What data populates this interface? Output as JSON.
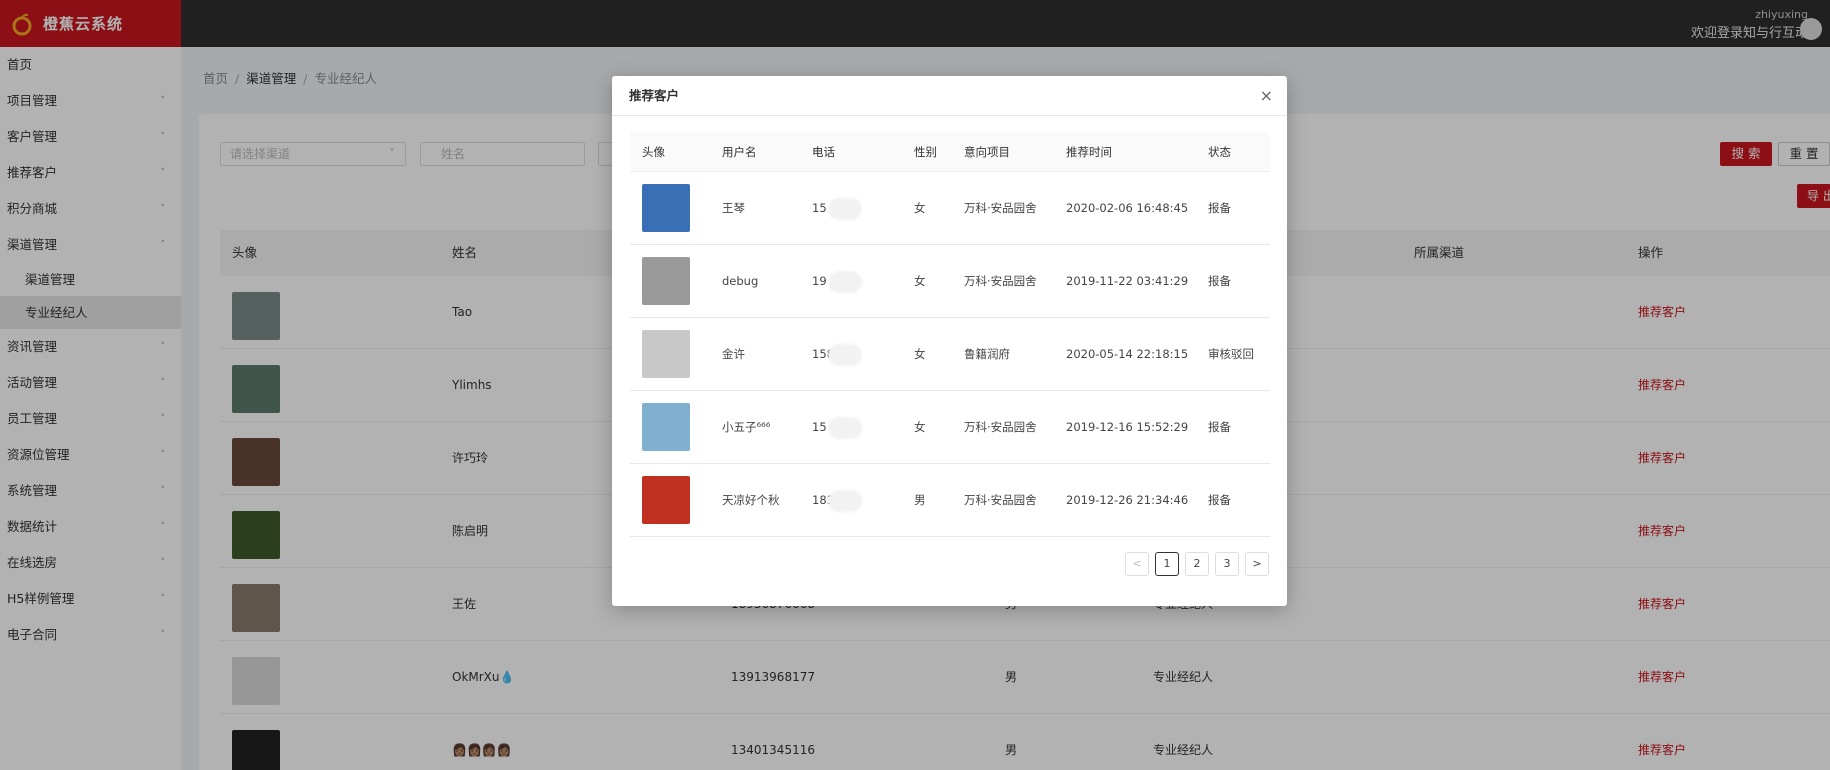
{
  "app": {
    "title": "橙蕉云系统",
    "user_name": "zhiyuxing",
    "welcome": "欢迎登录知与行互动"
  },
  "sidebar": {
    "items": [
      {
        "label": "首页",
        "chev": ""
      },
      {
        "label": "项目管理",
        "chev": "˅"
      },
      {
        "label": "客户管理",
        "chev": "˅"
      },
      {
        "label": "推荐客户",
        "chev": "˅"
      },
      {
        "label": "积分商城",
        "chev": "˅"
      },
      {
        "label": "渠道管理",
        "chev": "˄"
      }
    ],
    "sub_items": [
      {
        "label": "渠道管理"
      },
      {
        "label": "专业经纪人"
      }
    ],
    "items_after": [
      {
        "label": "资讯管理",
        "chev": "˅"
      },
      {
        "label": "活动管理",
        "chev": "˅"
      },
      {
        "label": "员工管理",
        "chev": "˅"
      },
      {
        "label": "资源位管理",
        "chev": "˅"
      },
      {
        "label": "系统管理",
        "chev": "˅"
      },
      {
        "label": "数据统计",
        "chev": "˅"
      },
      {
        "label": "在线选房",
        "chev": "˅"
      },
      {
        "label": "H5样例管理",
        "chev": "˅"
      },
      {
        "label": "电子合同",
        "chev": "˅"
      }
    ]
  },
  "breadcrumb": {
    "home": "首页",
    "level1": "渠道管理",
    "level2": "专业经纪人",
    "sep": "/"
  },
  "filters": {
    "channel_placeholder": "请选择渠道",
    "name_placeholder": "姓名",
    "search": "搜 索",
    "reset": "重 置",
    "export": "导 出"
  },
  "table": {
    "headers": {
      "avatar": "头像",
      "name": "姓名",
      "channel": "所属渠道",
      "action": "操作"
    },
    "rows": [
      {
        "name": "Tao",
        "phone": "",
        "gender": "",
        "type": "",
        "action": "推荐客户",
        "color": "#7a8c88"
      },
      {
        "name": "Ylimhs",
        "phone": "",
        "gender": "",
        "type": "",
        "action": "推荐客户",
        "color": "#5d7a6e"
      },
      {
        "name": "许巧玲",
        "phone": "",
        "gender": "",
        "type": "",
        "action": "推荐客户",
        "color": "#6a4a3a"
      },
      {
        "name": "陈启明",
        "phone": "",
        "gender": "",
        "type": "",
        "action": "推荐客户",
        "color": "#3e5a2a"
      },
      {
        "name": "王佐",
        "phone": "18936876668",
        "gender": "男",
        "type": "专业经纪人",
        "action": "推荐客户",
        "color": "#8a7a6a"
      },
      {
        "name": "OkMrXu💧",
        "phone": "13913968177",
        "gender": "男",
        "type": "专业经纪人",
        "action": "推荐客户",
        "color": "#d8d8d8"
      },
      {
        "name": "👩🏽👩🏽👩🏽👩🏽",
        "phone": "13401345116",
        "gender": "男",
        "type": "专业经纪人",
        "action": "推荐客户",
        "color": "#222222"
      }
    ]
  },
  "modal": {
    "title": "推荐客户",
    "close": "×",
    "headers": {
      "avatar": "头像",
      "username": "用户名",
      "phone": "电话",
      "gender": "性别",
      "project": "意向项目",
      "time": "推荐时间",
      "status": "状态"
    },
    "rows": [
      {
        "username": "王琴",
        "phone": "15        0361",
        "gender": "女",
        "project": "万科·安品园舍",
        "time": "2020-02-06 16:48:45",
        "status": "报备",
        "color": "#3a6fb5"
      },
      {
        "username": "debug",
        "phone": "19        2048",
        "gender": "女",
        "project": "万科·安品园舍",
        "time": "2019-11-22 03:41:29",
        "status": "报备",
        "color": "#9a9a9a"
      },
      {
        "username": "金许",
        "phone": "158        362",
        "gender": "女",
        "project": "鲁籍润府",
        "time": "2020-05-14 22:18:15",
        "status": "审核驳回",
        "color": "#c8c8c8"
      },
      {
        "username": "小五子⁶⁶⁶",
        "phone": "15        7773",
        "gender": "女",
        "project": "万科·安品园舍",
        "time": "2019-12-16 15:52:29",
        "status": "报备",
        "color": "#7fb0d0"
      },
      {
        "username": "天凉好个秋",
        "phone": "183        598",
        "gender": "男",
        "project": "万科·安品园舍",
        "time": "2019-12-26 21:34:46",
        "status": "报备",
        "color": "#c03020"
      }
    ],
    "pagination": {
      "prev": "<",
      "pages": [
        "1",
        "2",
        "3"
      ],
      "next": ">",
      "current": "1"
    }
  }
}
